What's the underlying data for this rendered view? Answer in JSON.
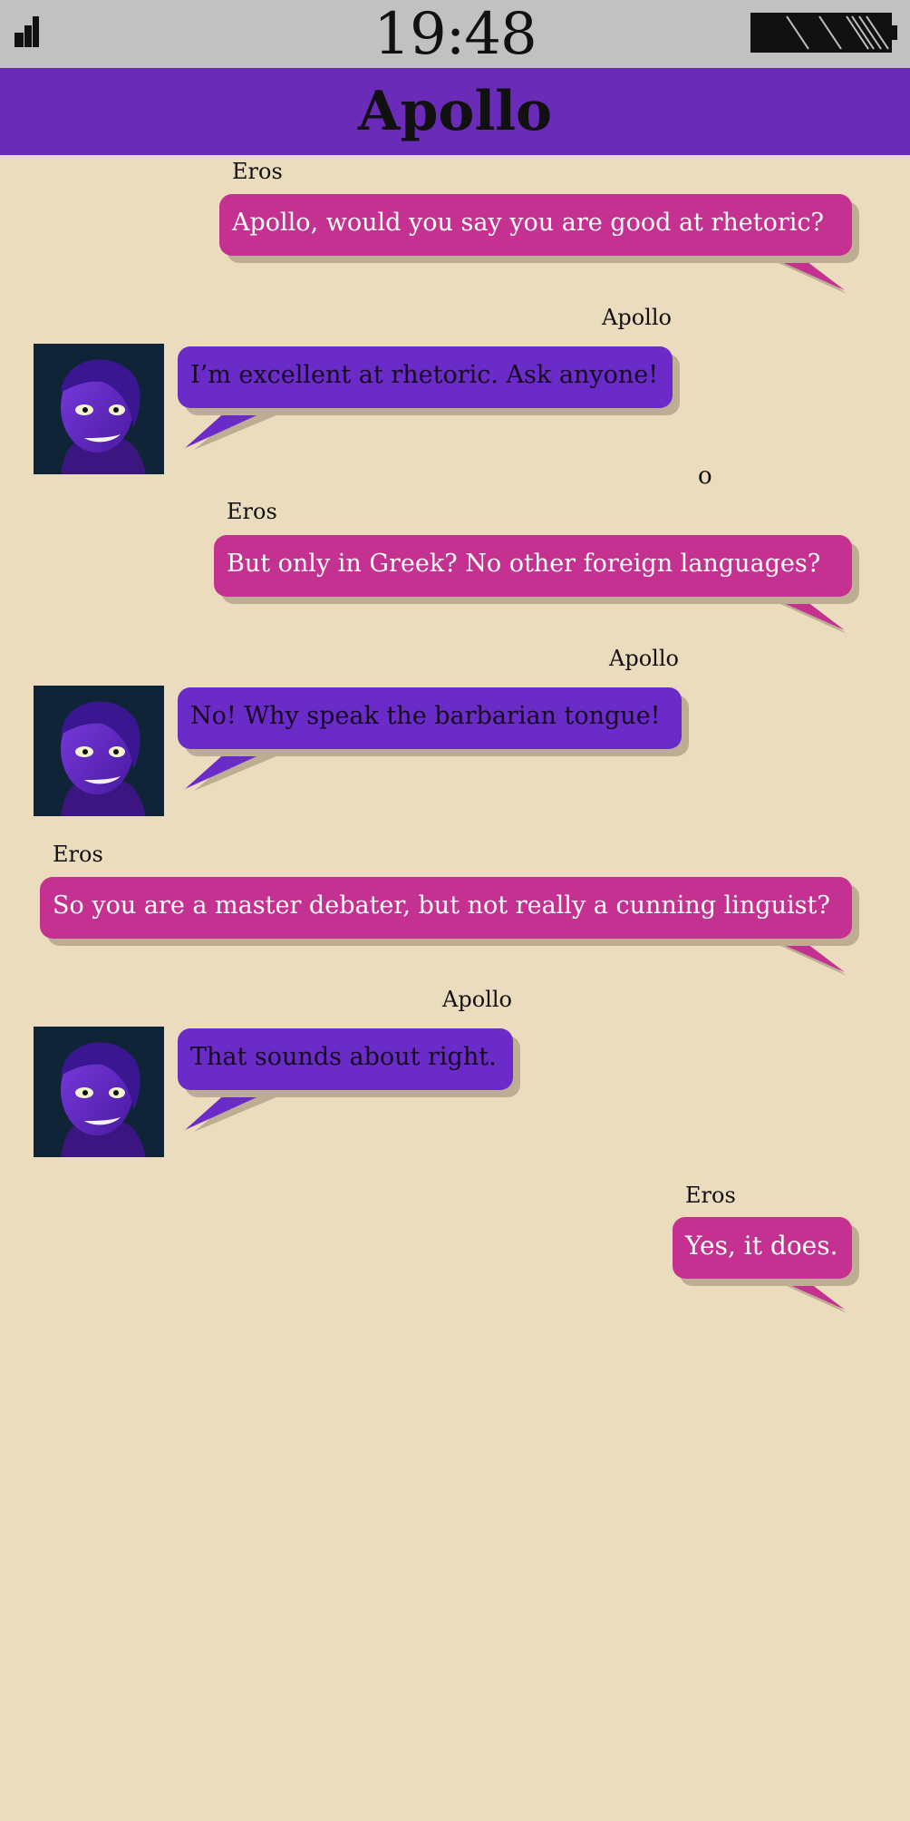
{
  "status_bar": {
    "time": "19:48",
    "signal_icon": "signal-bars-icon",
    "battery_icon": "battery-full-icon"
  },
  "header": {
    "title": "Apollo"
  },
  "colors": {
    "background": "#ecdcbe",
    "header": "#6a2bb9",
    "eros_bubble": "#c43191",
    "apollo_bubble": "#6a2bc9",
    "status_bar": "#c1c1c1"
  },
  "messages": [
    {
      "sender": "Eros",
      "text": "Apollo, would you say you are good at rhetoric?"
    },
    {
      "sender": "Apollo",
      "text": "I’m excellent at rhetoric. Ask anyone!"
    },
    {
      "sender": "Eros",
      "text": "But only in Greek? No other foreign languages?"
    },
    {
      "sender": "Apollo",
      "text": "No! Why speak the barbarian tongue!"
    },
    {
      "sender": "Eros",
      "text": "So you are a master debater, but not really a cunning linguist?"
    },
    {
      "sender": "Apollo",
      "text": "That sounds about right."
    },
    {
      "sender": "Eros",
      "text": "Yes, it does."
    }
  ],
  "stray_mark": "o"
}
